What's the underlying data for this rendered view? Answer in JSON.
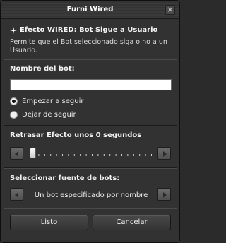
{
  "window": {
    "title": "Furni Wired"
  },
  "effect": {
    "title": "Efecto WIRED: Bot Sigue a Usuario",
    "description": "Permite que el Bot seleccionado siga o no a un Usuario."
  },
  "bot_name": {
    "label": "Nombre del bot:",
    "value": ""
  },
  "options": [
    {
      "label": "Empezar a seguir",
      "checked": true
    },
    {
      "label": "Dejar de seguir",
      "checked": false
    }
  ],
  "delay": {
    "label": "Retrasar Efecto unos 0 segundos",
    "value": 0
  },
  "source": {
    "label": "Seleccionar fuente de bots:",
    "value": "Un bot especificado por nombre"
  },
  "buttons": {
    "ok": "Listo",
    "cancel": "Cancelar"
  },
  "icons": {
    "close": "close-icon",
    "effect": "sparkle-icon",
    "left": "arrow-left-icon",
    "right": "arrow-right-icon"
  }
}
